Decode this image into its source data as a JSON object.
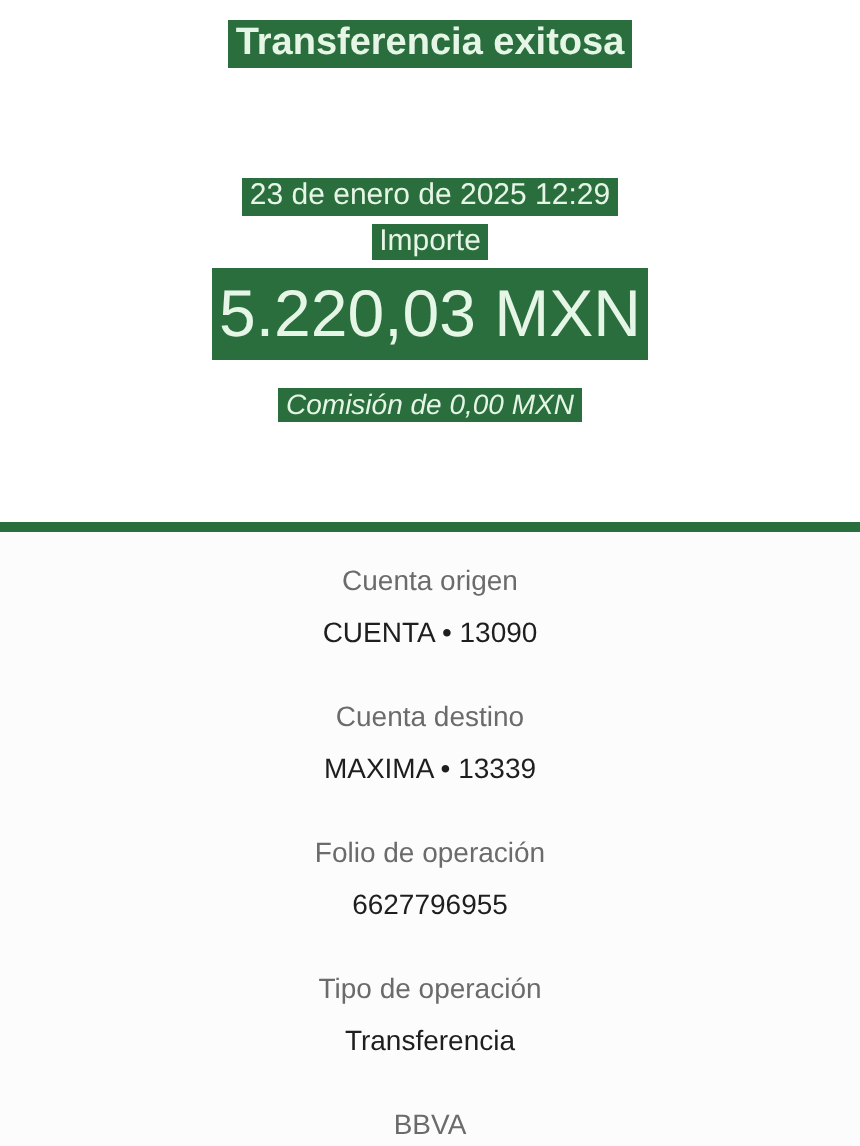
{
  "header": {
    "title": "Transferencia exitosa",
    "date": "23 de enero de 2025 12:29",
    "amount_label": "Importe",
    "amount": "5.220,03 MXN",
    "fee": "Comisión de 0,00 MXN"
  },
  "details": [
    {
      "label": "Cuenta origen",
      "value": "CUENTA • 13090"
    },
    {
      "label": "Cuenta destino",
      "value": "MAXIMA • 13339"
    },
    {
      "label": "Folio de operación",
      "value": "6627796955"
    },
    {
      "label": "Tipo de operación",
      "value": "Transferencia"
    },
    {
      "label": "BBVA"
    }
  ]
}
